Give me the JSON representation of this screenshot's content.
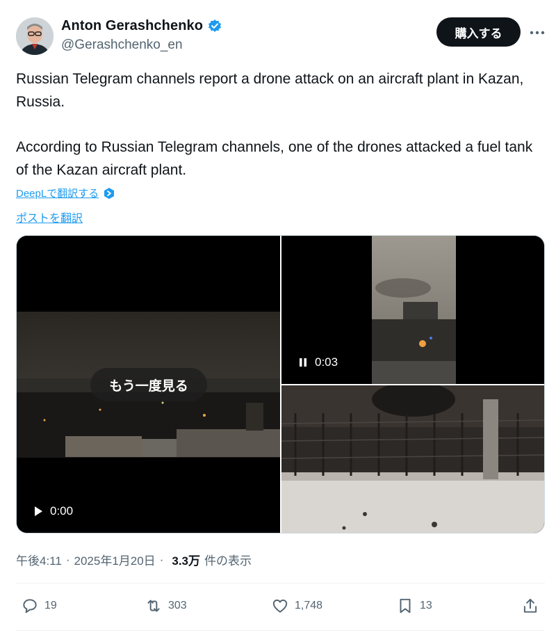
{
  "author": {
    "display_name": "Anton Gerashchenko",
    "handle": "@Gerashchenko_en",
    "verified": true
  },
  "header": {
    "buy_label": "購入する"
  },
  "tweet": {
    "paragraph1": "Russian Telegram channels report a drone attack on an aircraft plant in Kazan, Russia.",
    "paragraph2": "According to Russian Telegram channels, one of the drones attacked a fuel tank of the Kazan aircraft plant.",
    "deepl_label": "DeepLで翻訳する",
    "translate_label": "ポストを翻訳"
  },
  "media": {
    "video1": {
      "replay_label": "もう一度見る",
      "time": "0:00",
      "control": "play-icon"
    },
    "video2": {
      "time": "0:03",
      "control": "pause-icon"
    }
  },
  "meta": {
    "time": "午後4:11",
    "date": "2025年1月20日",
    "views_count": "3.3万",
    "views_label": "件の表示",
    "separator": "·"
  },
  "actions": {
    "replies": "19",
    "reposts": "303",
    "likes": "1,748",
    "bookmarks": "13"
  },
  "colors": {
    "accent": "#1d9bf0",
    "text_primary": "#0f1419",
    "text_secondary": "#536471",
    "button_dark": "#0f1419"
  }
}
